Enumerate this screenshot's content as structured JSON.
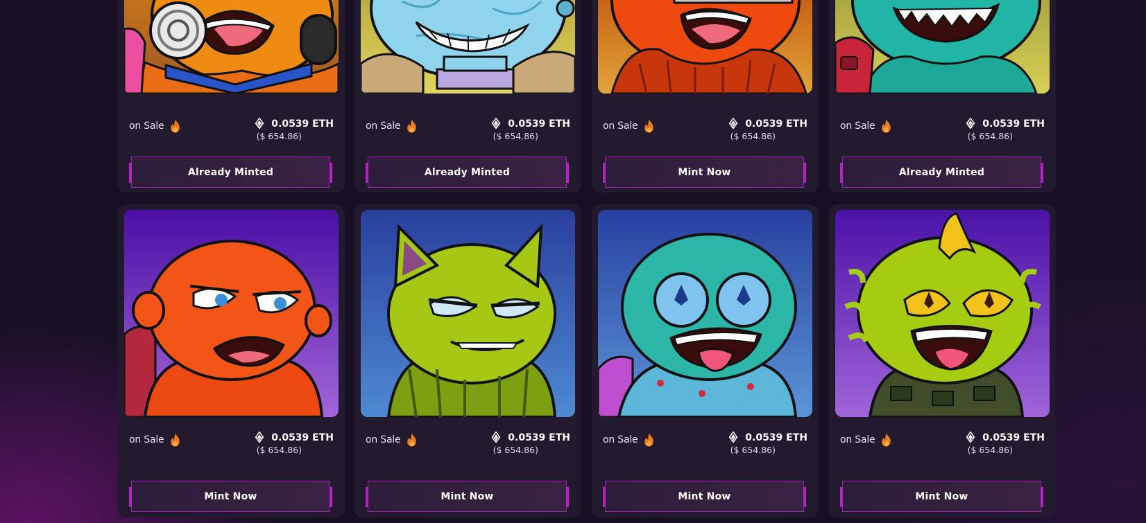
{
  "colors": {
    "page_background": "#181126",
    "card_background": "#221a2e",
    "button_border": "#a41fb0",
    "flame": "#f07a1d"
  },
  "icons": {
    "status": "flame-icon",
    "currency": "ethereum-icon"
  },
  "cards": [
    {
      "status": "on Sale",
      "price_eth": "0.0539 ETH",
      "price_usd": "($ 654.86)",
      "button": "Already Minted",
      "art": "orange-creature-headphones"
    },
    {
      "status": "on Sale",
      "price_eth": "0.0539 ETH",
      "price_usd": "($ 654.86)",
      "button": "Already Minted",
      "art": "ice-blue-creature-backpack"
    },
    {
      "status": "on Sale",
      "price_eth": "0.0539 ETH",
      "price_usd": "($ 654.86)",
      "button": "Mint Now",
      "art": "red-bearded-creature"
    },
    {
      "status": "on Sale",
      "price_eth": "0.0539 ETH",
      "price_usd": "($ 654.86)",
      "button": "Already Minted",
      "art": "teal-lizard-creature"
    },
    {
      "status": "on Sale",
      "price_eth": "0.0539 ETH",
      "price_usd": "($ 654.86)",
      "button": "Mint Now",
      "art": "sad-orange-creature"
    },
    {
      "status": "on Sale",
      "price_eth": "0.0539 ETH",
      "price_usd": "($ 654.86)",
      "button": "Mint Now",
      "art": "green-furry-cat-creature"
    },
    {
      "status": "on Sale",
      "price_eth": "0.0539 ETH",
      "price_usd": "($ 654.86)",
      "button": "Mint Now",
      "art": "teal-creature-eth-eyes"
    },
    {
      "status": "on Sale",
      "price_eth": "0.0539 ETH",
      "price_usd": "($ 654.86)",
      "button": "Mint Now",
      "art": "lime-creature-banana-hair"
    }
  ]
}
